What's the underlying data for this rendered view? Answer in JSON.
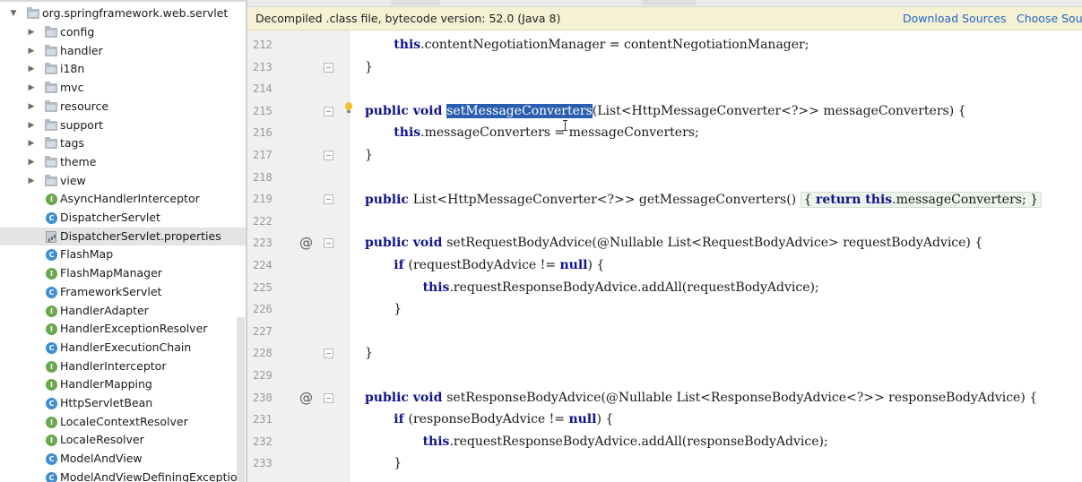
{
  "project_tree": {
    "root": {
      "label": "org.springframework.web.servlet"
    },
    "folders": [
      {
        "label": "config"
      },
      {
        "label": "handler"
      },
      {
        "label": "i18n"
      },
      {
        "label": "mvc"
      },
      {
        "label": "resource"
      },
      {
        "label": "support"
      },
      {
        "label": "tags"
      },
      {
        "label": "theme"
      },
      {
        "label": "view"
      }
    ],
    "files": [
      {
        "label": "AsyncHandlerInterceptor",
        "icon": "interface-icon"
      },
      {
        "label": "DispatcherServlet",
        "icon": "class-icon"
      },
      {
        "label": "DispatcherServlet.properties",
        "icon": "properties-file-icon",
        "selected": true
      },
      {
        "label": "FlashMap",
        "icon": "class-icon"
      },
      {
        "label": "FlashMapManager",
        "icon": "interface-icon"
      },
      {
        "label": "FrameworkServlet",
        "icon": "class-icon"
      },
      {
        "label": "HandlerAdapter",
        "icon": "interface-icon"
      },
      {
        "label": "HandlerExceptionResolver",
        "icon": "interface-icon"
      },
      {
        "label": "HandlerExecutionChain",
        "icon": "class-icon"
      },
      {
        "label": "HandlerInterceptor",
        "icon": "interface-icon"
      },
      {
        "label": "HandlerMapping",
        "icon": "interface-icon"
      },
      {
        "label": "HttpServletBean",
        "icon": "class-icon"
      },
      {
        "label": "LocaleContextResolver",
        "icon": "interface-icon"
      },
      {
        "label": "LocaleResolver",
        "icon": "interface-icon"
      },
      {
        "label": "ModelAndView",
        "icon": "class-icon"
      },
      {
        "label": "ModelAndViewDefiningException",
        "icon": "class-icon"
      }
    ]
  },
  "banner": {
    "text": "Decompiled .class file, bytecode version: 52.0 (Java 8)",
    "download_sources": "Download Sources",
    "choose_sources": "Choose Sources..."
  },
  "editor": {
    "lines": [
      {
        "num": "212",
        "indent": 2,
        "parts": [
          [
            "kw",
            "this"
          ],
          [
            "t",
            ".contentNegotiationManager = contentNegotiationManager;"
          ]
        ]
      },
      {
        "num": "213",
        "indent": 1,
        "fold": true,
        "parts": [
          [
            "t",
            "}"
          ]
        ]
      },
      {
        "num": "214",
        "indent": 0,
        "parts": []
      },
      {
        "num": "215",
        "indent": 1,
        "fold": true,
        "bulb": true,
        "parts": [
          [
            "kw",
            "public void "
          ],
          [
            "hl",
            "setMessageConverters"
          ],
          [
            "t",
            "(List<HttpMessageConverter<?>> messageConverters) {"
          ]
        ]
      },
      {
        "num": "216",
        "indent": 2,
        "parts": [
          [
            "kw",
            "this"
          ],
          [
            "t",
            ".messageConverters = messageConverters;"
          ]
        ]
      },
      {
        "num": "217",
        "indent": 1,
        "fold": true,
        "parts": [
          [
            "t",
            "}"
          ]
        ]
      },
      {
        "num": "218",
        "indent": 0,
        "parts": []
      },
      {
        "num": "219",
        "indent": 1,
        "fold": true,
        "parts": [
          [
            "kw",
            "public "
          ],
          [
            "t",
            "List<HttpMessageConverter<?>> getMessageConverters() "
          ],
          [
            "fb_open",
            "{ "
          ],
          [
            "kw",
            "return this"
          ],
          [
            "t",
            ".messageConverters; "
          ],
          [
            "fb_close",
            "}"
          ]
        ]
      },
      {
        "num": "222",
        "indent": 0,
        "parts": []
      },
      {
        "num": "223",
        "indent": 1,
        "fold": true,
        "at": true,
        "parts": [
          [
            "kw",
            "public void "
          ],
          [
            "t",
            "setRequestBodyAdvice(@Nullable List<RequestBodyAdvice> requestBodyAdvice) {"
          ]
        ]
      },
      {
        "num": "224",
        "indent": 2,
        "parts": [
          [
            "kw",
            "if "
          ],
          [
            "t",
            "(requestBodyAdvice != "
          ],
          [
            "kw",
            "null"
          ],
          [
            "t",
            ") {"
          ]
        ]
      },
      {
        "num": "225",
        "indent": 3,
        "parts": [
          [
            "kw",
            "this"
          ],
          [
            "t",
            ".requestResponseBodyAdvice.addAll(requestBodyAdvice);"
          ]
        ]
      },
      {
        "num": "226",
        "indent": 2,
        "parts": [
          [
            "t",
            "}"
          ]
        ]
      },
      {
        "num": "227",
        "indent": 0,
        "parts": []
      },
      {
        "num": "228",
        "indent": 1,
        "fold": true,
        "parts": [
          [
            "t",
            "}"
          ]
        ]
      },
      {
        "num": "229",
        "indent": 0,
        "parts": []
      },
      {
        "num": "230",
        "indent": 1,
        "fold": true,
        "at": true,
        "parts": [
          [
            "kw",
            "public void "
          ],
          [
            "t",
            "setResponseBodyAdvice(@Nullable List<ResponseBodyAdvice<?>> responseBodyAdvice) {"
          ]
        ]
      },
      {
        "num": "231",
        "indent": 2,
        "parts": [
          [
            "kw",
            "if "
          ],
          [
            "t",
            "(responseBodyAdvice != "
          ],
          [
            "kw",
            "null"
          ],
          [
            "t",
            ") {"
          ]
        ]
      },
      {
        "num": "232",
        "indent": 3,
        "parts": [
          [
            "kw",
            "this"
          ],
          [
            "t",
            ".requestResponseBodyAdvice.addAll(responseBodyAdvice);"
          ]
        ]
      },
      {
        "num": "233",
        "indent": 2,
        "parts": [
          [
            "t",
            "}"
          ]
        ]
      }
    ]
  },
  "colors": {
    "keyword": "#10148c",
    "selection": "#2a5fb0",
    "banner_bg": "#f5f1d4",
    "link": "#2467c4"
  }
}
